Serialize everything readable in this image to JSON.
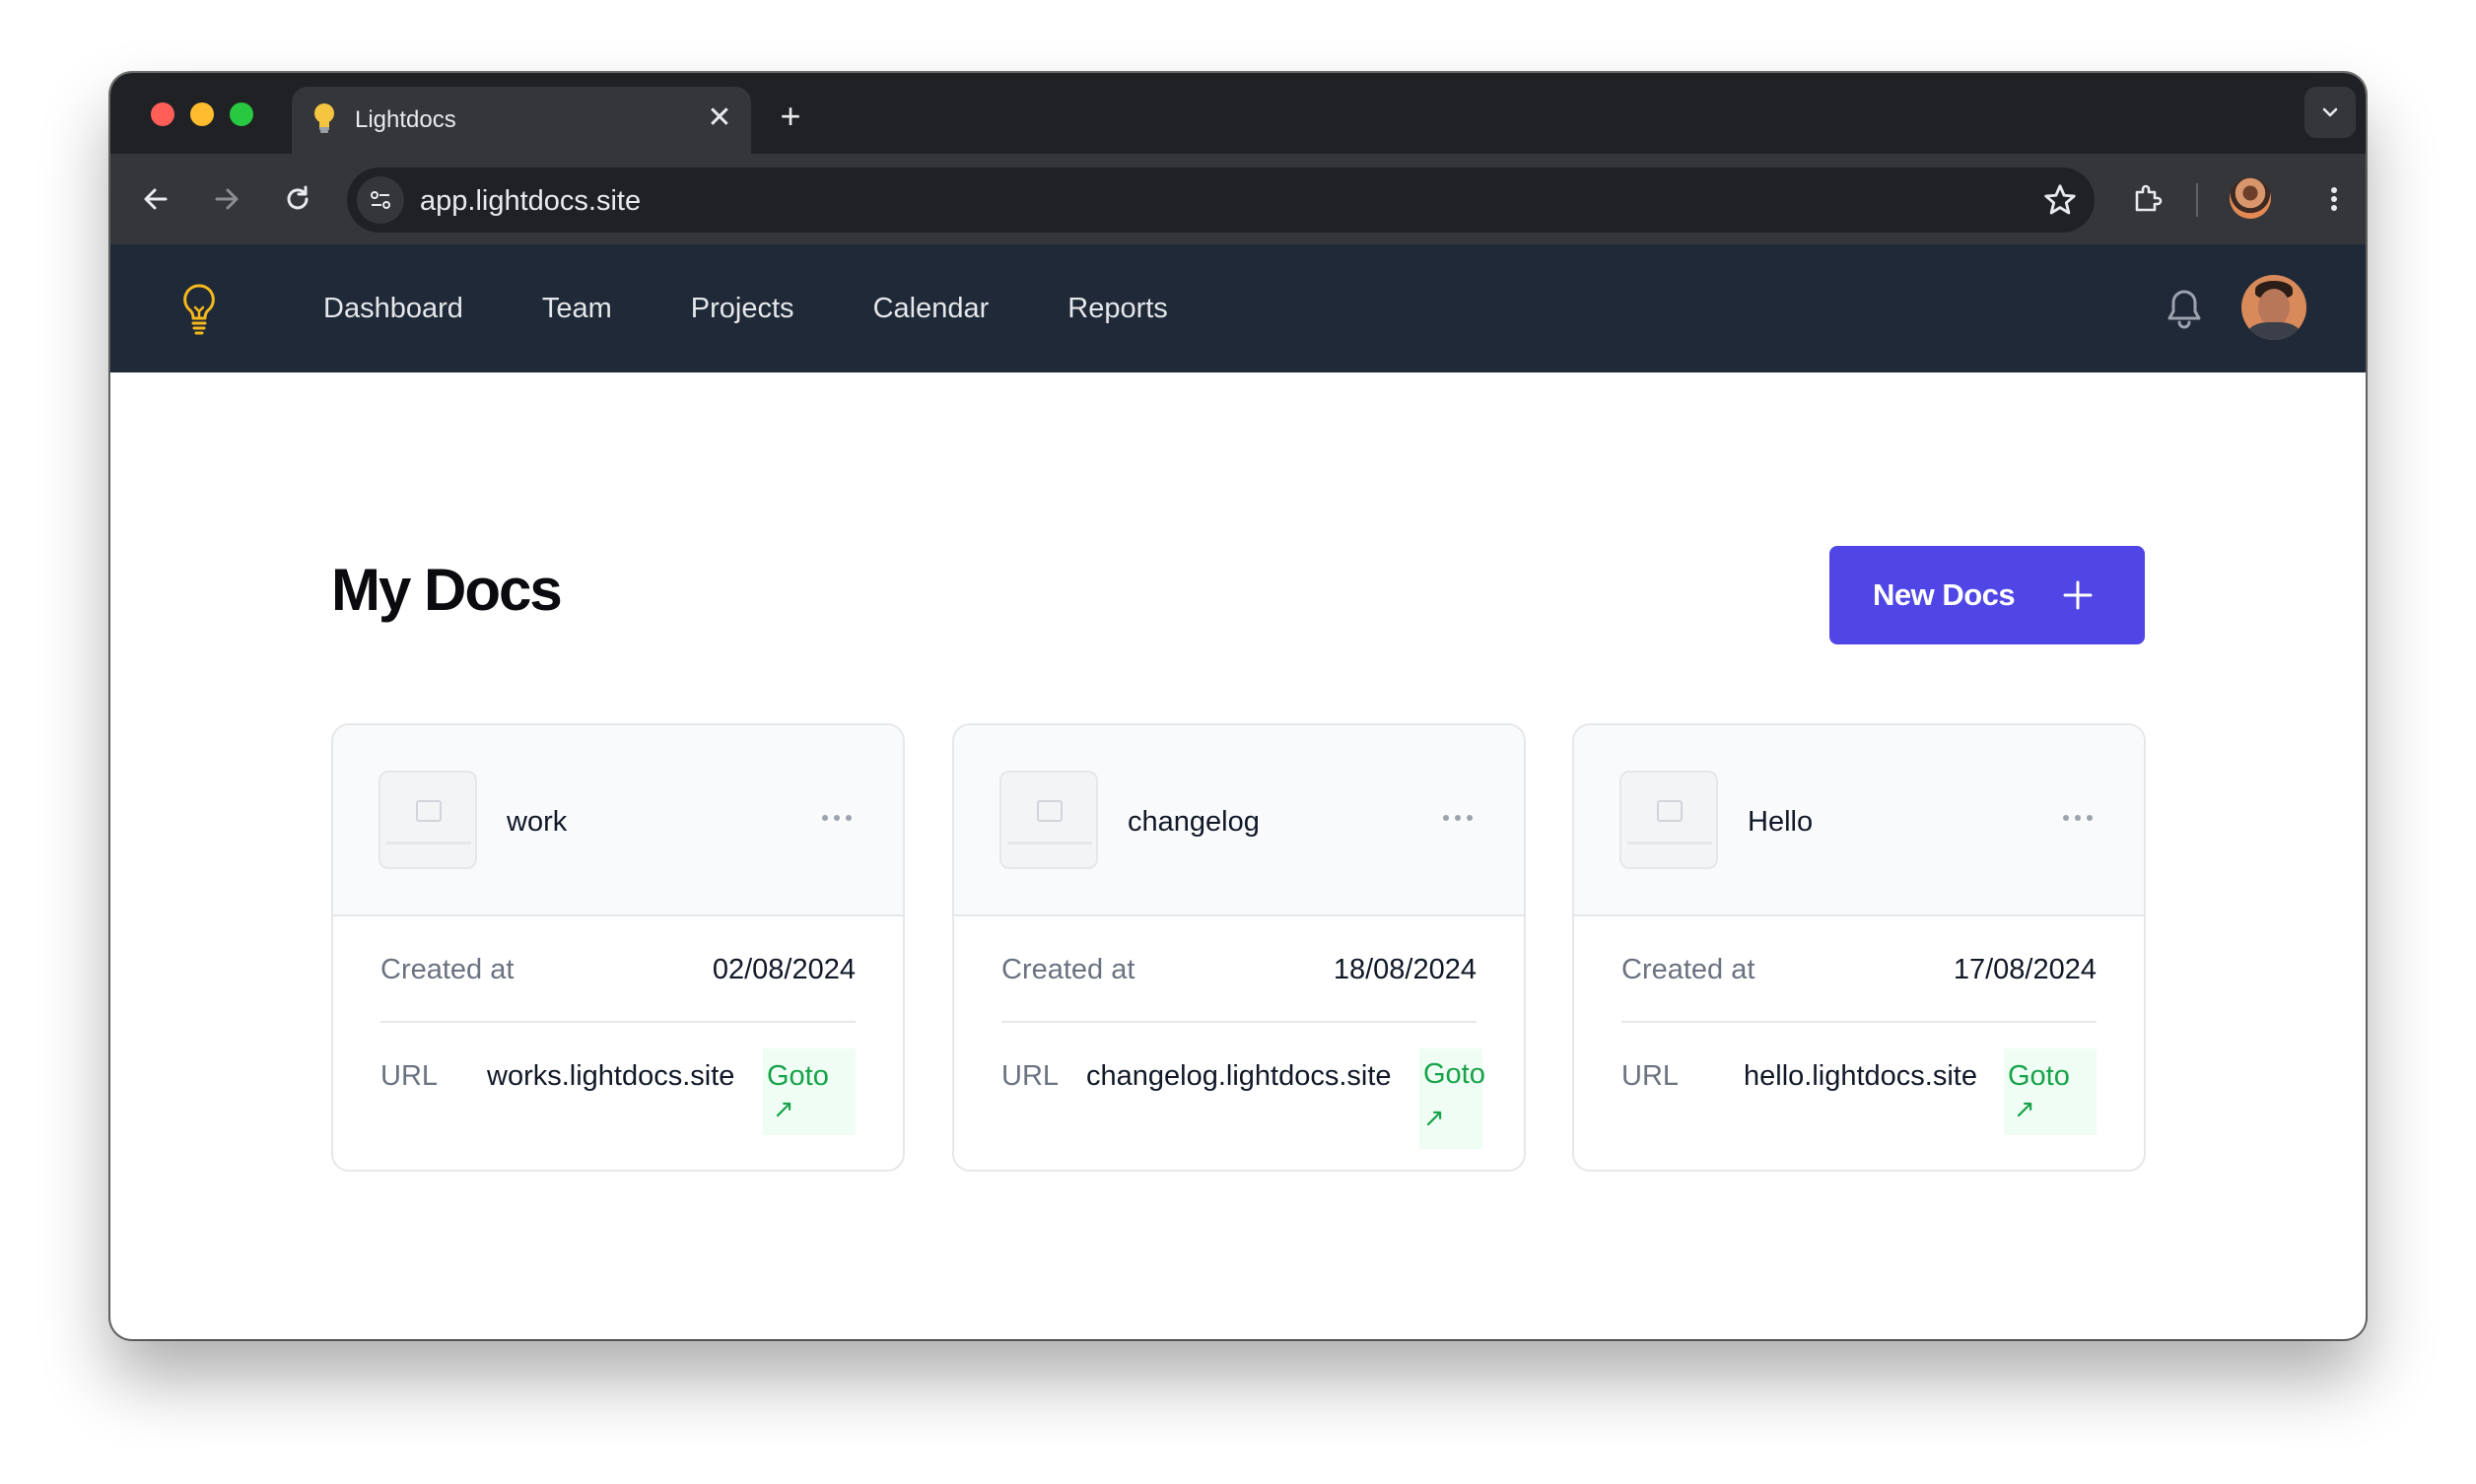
{
  "browser": {
    "tab_title": "Lightdocs",
    "url": "app.lightdocs.site"
  },
  "nav": {
    "items": [
      "Dashboard",
      "Team",
      "Projects",
      "Calendar",
      "Reports"
    ]
  },
  "main": {
    "title": "My Docs",
    "new_button_label": "New Docs",
    "cards": [
      {
        "name": "work",
        "created_label": "Created at",
        "created": "02/08/2024",
        "url_label": "URL",
        "url": "works.lightdocs.site",
        "goto": "Goto"
      },
      {
        "name": "changelog",
        "created_label": "Created at",
        "created": "18/08/2024",
        "url_label": "URL",
        "url": "changelog.lightdocs.site",
        "goto": "Goto"
      },
      {
        "name": "Hello",
        "created_label": "Created at",
        "created": "17/08/2024",
        "url_label": "URL",
        "url": "hello.lightdocs.site",
        "goto": "Goto"
      }
    ]
  },
  "colors": {
    "accent": "#4f46e5",
    "navbar": "#1f2937",
    "goto_green": "#16a34a",
    "logo_yellow": "#f5b91e"
  },
  "icons": [
    "lightbulb-icon",
    "close-icon",
    "plus-icon",
    "back-icon",
    "forward-icon",
    "reload-icon",
    "site-settings-icon",
    "star-icon",
    "extensions-icon",
    "kebab-menu-icon",
    "bell-icon",
    "ellipsis-icon",
    "arrow-up-right-icon",
    "chevron-down-icon"
  ]
}
